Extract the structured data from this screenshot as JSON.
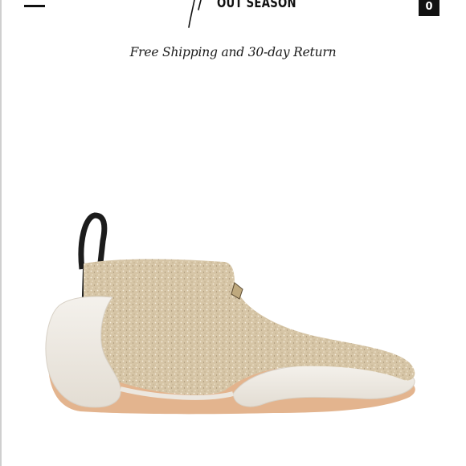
{
  "header": {
    "menu_icon": "hamburger-menu-icon",
    "logo_text": "OUT SEASON",
    "cart_count": "0",
    "cart_icon": "shopping-bag-icon"
  },
  "banner": {
    "text": "Free Shipping and 30-day Return"
  },
  "product": {
    "image_subject": "glitter-gold-high-top-sneaker",
    "colors": {
      "glitter": "#d8c7a8",
      "sole": "#f1ede6",
      "outsole": "#e3b48e",
      "pull_tab": "#1c1c1c"
    }
  }
}
